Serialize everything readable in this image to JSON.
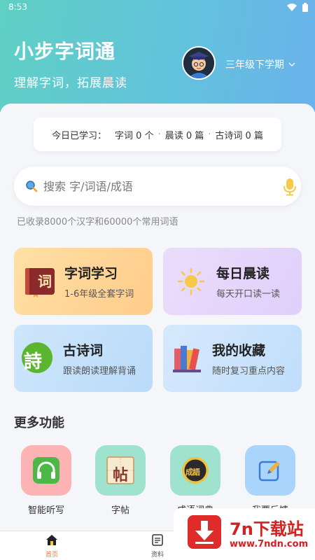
{
  "status_bar": {
    "time": "8:53"
  },
  "header": {
    "title": "小步字词通",
    "subtitle": "理解字词，拓展晨读",
    "grade": "三年级下学期",
    "gradient": [
      "#5fd0c4",
      "#6ab2ec"
    ]
  },
  "progress": {
    "label": "今日已学习：",
    "items": [
      "字词 0 个",
      "晨读 0 篇",
      "古诗词 0 篇"
    ],
    "separator": "·"
  },
  "search": {
    "placeholder": "搜索 字/词语/成语",
    "stats": "已收录8000个汉字和60000个常用词语"
  },
  "tiles": [
    {
      "title": "字词学习",
      "desc": "1-6年级全套字词",
      "icon_glyph": "词"
    },
    {
      "title": "每日晨读",
      "desc": "每天开口读一读"
    },
    {
      "title": "古诗词",
      "desc": "跟读朗读理解背诵",
      "icon_glyph": "詩"
    },
    {
      "title": "我的收藏",
      "desc": "随时复习重点内容"
    }
  ],
  "more": {
    "title": "更多功能",
    "items": [
      {
        "label": "智能听写",
        "icon": "headphones-icon",
        "color": "#fdb3b3"
      },
      {
        "label": "字帖",
        "icon": "calligraphy-icon",
        "color": "#9fe3cf",
        "glyph": "帖"
      },
      {
        "label": "成语词典",
        "icon": "idiom-icon",
        "color": "#9fe3cf",
        "glyph": "成語"
      },
      {
        "label": "我要反馈",
        "icon": "feedback-icon",
        "color": "#a9d4fb"
      }
    ]
  },
  "tabbar": {
    "items": [
      {
        "label": "首页",
        "active": true
      },
      {
        "label": "资料",
        "active": false
      }
    ],
    "active_color": "#e8763a"
  },
  "watermark": {
    "brand": "7n下载站",
    "url": "www.7ndn.com"
  }
}
